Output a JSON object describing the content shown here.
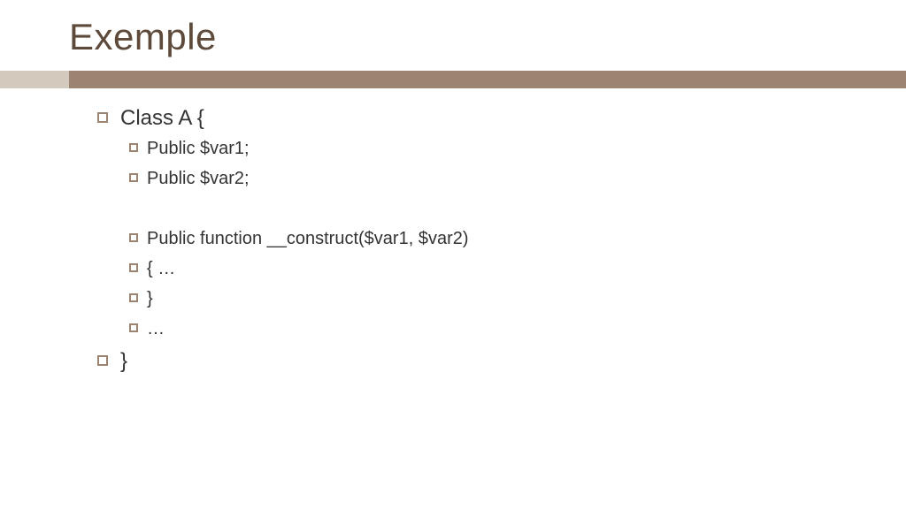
{
  "title": "Exemple",
  "colors": {
    "titleColor": "#5e4a3a",
    "dividerLight": "#d4c9bd",
    "dividerDark": "#9b8472",
    "bulletBorder": "#9b8472"
  },
  "bullets": {
    "line1": "Class A {",
    "line2": "Public $var1;",
    "line3": "Public $var2;",
    "line4": "Public function __construct($var1, $var2)",
    "line5": "{ …",
    "line6": "}",
    "line7": "…",
    "line8": "}"
  }
}
